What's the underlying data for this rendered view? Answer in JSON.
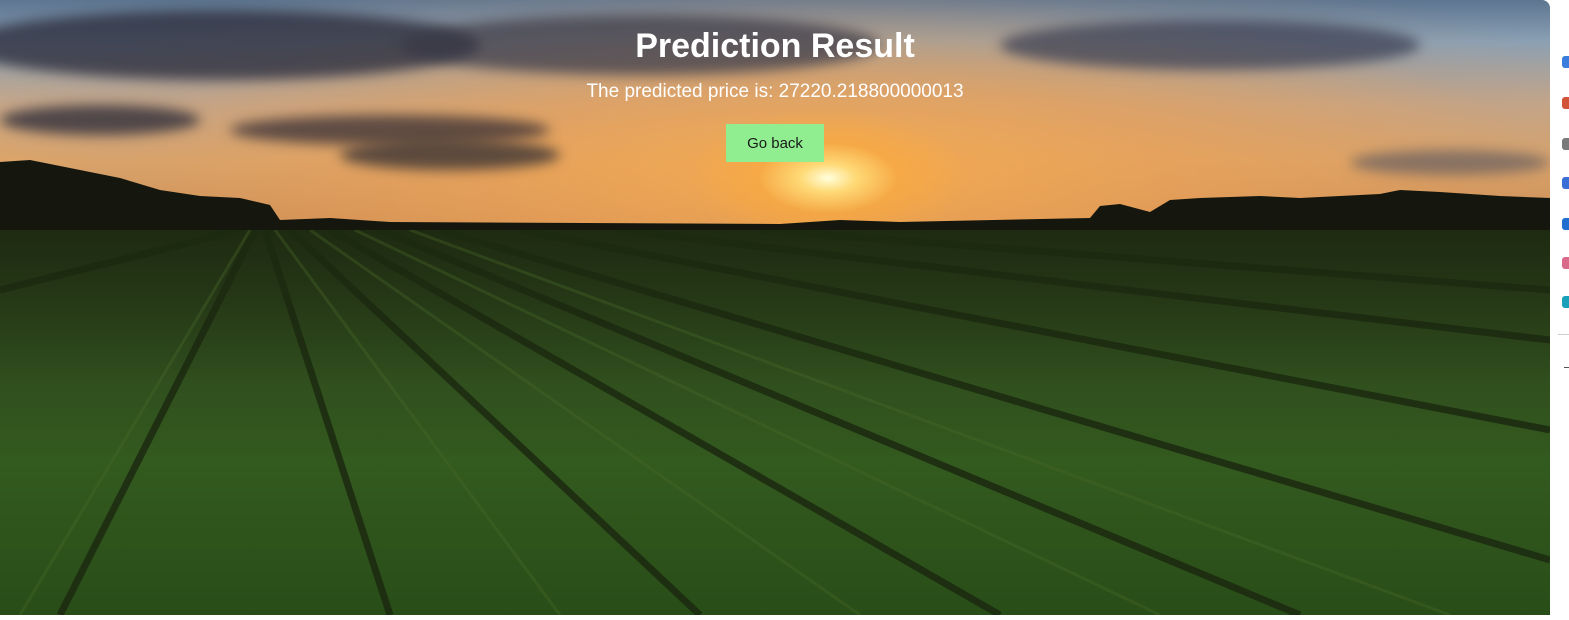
{
  "page": {
    "title": "Prediction Result",
    "result_text": "The predicted price is: 27220.218800000013",
    "go_back_label": "Go back"
  },
  "colors": {
    "button_background": "#90ee90",
    "heading_text": "#ffffff"
  },
  "background": {
    "icon": "sunset-farm-field-image"
  },
  "side_panel": {
    "icons": [
      "blue-icon",
      "orange-icon",
      "gray-icon",
      "blue-icon",
      "blue-icon",
      "multicolor-icon",
      "teal-icon"
    ]
  }
}
